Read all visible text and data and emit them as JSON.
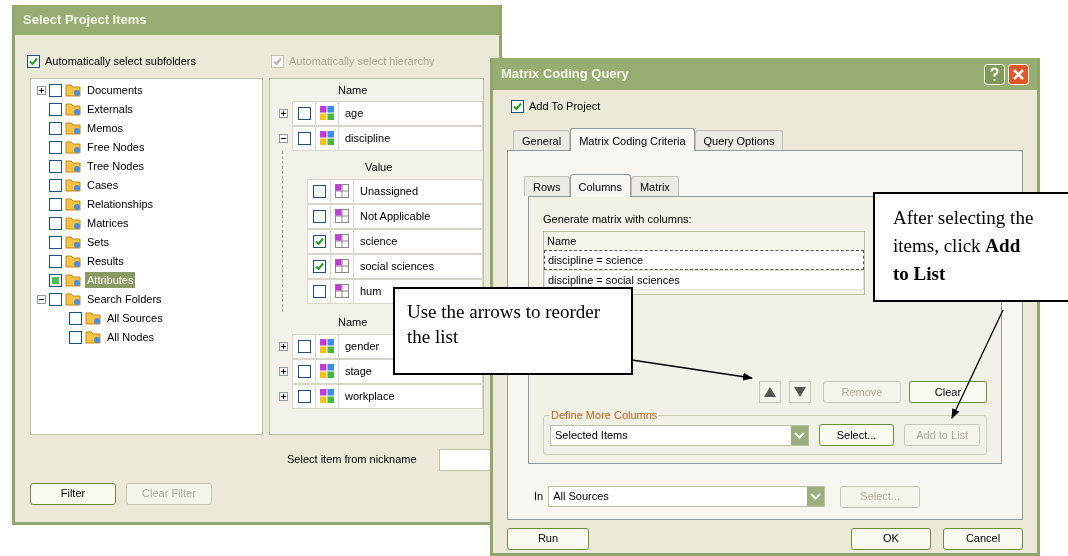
{
  "select_window": {
    "title": "Select Project Items",
    "auto_subfolders": {
      "label": "Automatically select subfolders",
      "checked": true
    },
    "auto_hierarchy": {
      "label": "Automatically select hierarchy",
      "checked": true,
      "disabled": true
    },
    "tree": [
      {
        "label": "Documents",
        "kind": "branch",
        "expanded": false,
        "checked": false,
        "partial": false,
        "selected": false
      },
      {
        "label": "Externals",
        "kind": "leaf",
        "checked": false,
        "partial": false,
        "selected": false
      },
      {
        "label": "Memos",
        "kind": "leaf",
        "checked": false,
        "partial": false,
        "selected": false
      },
      {
        "label": "Free Nodes",
        "kind": "leaf",
        "checked": false,
        "partial": false,
        "selected": false
      },
      {
        "label": "Tree Nodes",
        "kind": "leaf",
        "checked": false,
        "partial": false,
        "selected": false
      },
      {
        "label": "Cases",
        "kind": "leaf",
        "checked": false,
        "partial": false,
        "selected": false
      },
      {
        "label": "Relationships",
        "kind": "leaf",
        "checked": false,
        "partial": false,
        "selected": false
      },
      {
        "label": "Matrices",
        "kind": "leaf",
        "checked": false,
        "partial": false,
        "selected": false
      },
      {
        "label": "Sets",
        "kind": "leaf",
        "checked": false,
        "partial": false,
        "selected": false
      },
      {
        "label": "Results",
        "kind": "leaf",
        "checked": false,
        "partial": false,
        "selected": false
      },
      {
        "label": "Attributes",
        "kind": "leaf",
        "checked": false,
        "partial": true,
        "selected": true
      },
      {
        "label": "Search Folders",
        "kind": "branch",
        "expanded": true,
        "checked": false,
        "partial": false,
        "selected": false,
        "children": [
          {
            "label": "All Sources",
            "kind": "leaf",
            "checked": false,
            "partial": false,
            "selected": false
          },
          {
            "label": "All Nodes",
            "kind": "leaf",
            "checked": false,
            "partial": false,
            "selected": false
          }
        ]
      }
    ],
    "attributes": {
      "header": "Name",
      "rows": [
        {
          "name": "age",
          "checked": false,
          "expanded": false
        },
        {
          "name": "discipline",
          "checked": false,
          "expanded": true,
          "values_header": "Value",
          "values": [
            {
              "label": "Unassigned",
              "checked": false
            },
            {
              "label": "Not Applicable",
              "checked": false
            },
            {
              "label": "science",
              "checked": true
            },
            {
              "label": "social sciences",
              "checked": true
            },
            {
              "label": "hum",
              "checked": false
            }
          ],
          "next_header": "Name"
        },
        {
          "name": "gender",
          "checked": false,
          "expanded": false
        },
        {
          "name": "stage",
          "checked": false,
          "expanded": false
        },
        {
          "name": "workplace",
          "checked": false,
          "expanded": false
        }
      ]
    },
    "nickname_label": "Select item from nickname",
    "buttons": [
      {
        "label": "Filter",
        "disabled": false
      },
      {
        "label": "Clear Filter",
        "disabled": true
      }
    ]
  },
  "query_window": {
    "title": "Matrix Coding Query",
    "add_to_project": {
      "label": "Add To Project",
      "checked": true
    },
    "tabs": [
      {
        "label": "General",
        "selected": false
      },
      {
        "label": "Matrix Coding Criteria",
        "selected": true
      },
      {
        "label": "Query Options",
        "selected": false
      }
    ],
    "subtabs": [
      {
        "label": "Rows",
        "selected": false
      },
      {
        "label": "Columns",
        "selected": true
      },
      {
        "label": "Matrix",
        "selected": false
      }
    ],
    "list_caption": "Generate matrix with columns:",
    "list_header": "Name",
    "list_rows": [
      {
        "label": "discipline = science",
        "selected": true
      },
      {
        "label": "discipline = social sciences",
        "selected": false
      }
    ],
    "list_buttons": [
      {
        "label": "Remove",
        "disabled": true
      },
      {
        "label": "Clear",
        "disabled": false
      }
    ],
    "define_group": {
      "title": "Define More Columns",
      "dropdown": "Selected Items",
      "buttons": [
        {
          "label": "Select...",
          "disabled": false
        },
        {
          "label": "Add to List",
          "disabled": true
        }
      ]
    },
    "in_label": "In",
    "in_dropdown": "All Sources",
    "in_button": {
      "label": "Select...",
      "disabled": true
    },
    "run_button": {
      "label": "Run",
      "disabled": false
    },
    "dialog_buttons": [
      {
        "label": "OK",
        "disabled": false
      },
      {
        "label": "Cancel",
        "disabled": false
      }
    ]
  },
  "callouts": [
    {
      "text": "Use the arrows to reorder the list"
    },
    {
      "text": "After selecting the items, click **Add to List**"
    }
  ]
}
